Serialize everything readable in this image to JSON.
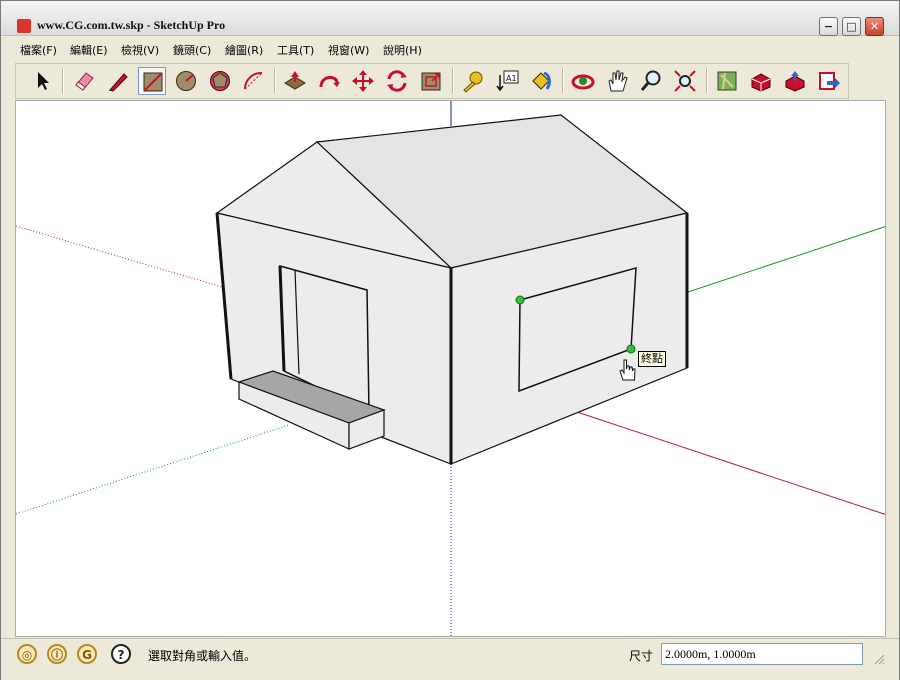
{
  "window": {
    "title": "www.CG.com.tw.skp - SketchUp Pro",
    "minimize_glyph": "−",
    "maximize_glyph": "□",
    "close_glyph": "✕"
  },
  "menu": {
    "items": [
      "檔案(F)",
      "編輯(E)",
      "檢視(V)",
      "鏡頭(C)",
      "繪圖(R)",
      "工具(T)",
      "視窗(W)",
      "說明(H)"
    ]
  },
  "toolbar": {
    "tools": [
      {
        "icon": "select-arrow-icon"
      },
      {
        "icon": "eraser-icon"
      },
      {
        "icon": "pencil-line-icon"
      },
      {
        "icon": "rectangle-icon",
        "active": true
      },
      {
        "icon": "circle-icon"
      },
      {
        "icon": "polygon-icon"
      },
      {
        "icon": "arc-icon"
      },
      {
        "icon": "push-pull-icon"
      },
      {
        "icon": "follow-me-icon"
      },
      {
        "icon": "move-icon"
      },
      {
        "icon": "rotate-icon"
      },
      {
        "icon": "offset-icon"
      },
      {
        "icon": "tape-measure-icon"
      },
      {
        "icon": "text-tool-icon",
        "label": "A1"
      },
      {
        "icon": "paint-bucket-icon"
      },
      {
        "icon": "orbit-icon"
      },
      {
        "icon": "pan-hand-icon"
      },
      {
        "icon": "zoom-icon"
      },
      {
        "icon": "zoom-extents-icon"
      },
      {
        "icon": "map-location-icon"
      },
      {
        "icon": "3d-warehouse-icon"
      },
      {
        "icon": "share-model-icon"
      },
      {
        "icon": "export-to-earth-icon"
      }
    ]
  },
  "viewport": {
    "inference_tooltip": "終點",
    "colors": {
      "red_axis": "#b0202a",
      "green_axis": "#1a9a1a",
      "blue_axis": "#1a1aa0",
      "face": "#ececec",
      "roof": "#e4e4e4",
      "step_top": "#a6a6a6",
      "inference_point": "#36c236"
    }
  },
  "statusbar": {
    "icons": [
      "geo-location-icon",
      "credits-icon",
      "user-account-icon",
      "help-icon"
    ],
    "message": "選取對角或輸入值。",
    "measurements_label": "尺寸",
    "measurements_value": "2.0000m, 1.0000m"
  }
}
